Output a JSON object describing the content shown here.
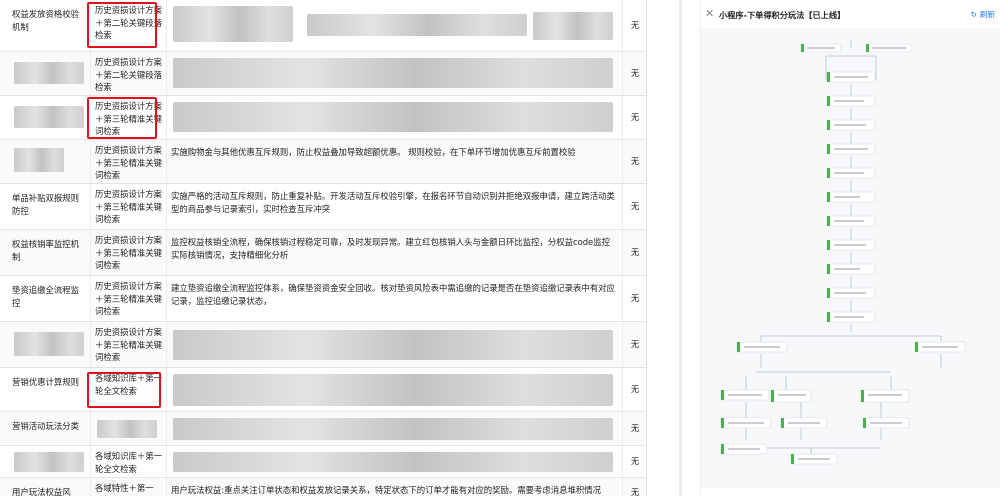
{
  "table": {
    "rows": [
      {
        "name": "权益发放资格校验机制",
        "method": "历史资损设计方案＋第二轮关键段落检索",
        "desc": "",
        "result": "无",
        "highlight": true
      },
      {
        "name": "",
        "method": "历史资损设计方案＋第二轮关键段落检索",
        "desc": "",
        "result": "无",
        "highlight": false
      },
      {
        "name": "",
        "method": "历史资损设计方案＋第三轮精准关键词检索",
        "desc": "",
        "result": "无",
        "highlight": true
      },
      {
        "name": "",
        "method": "历史资损设计方案＋第三轮精准关键词检索",
        "desc": "实施购物金与其他优惠互斥规则，防止权益叠加导致超额优惠。                              规则校验，在下单环节增加优惠互斥前置校验",
        "result": "无",
        "highlight": false
      },
      {
        "name": "单品补贴双报规则防控",
        "method": "历史资损设计方案＋第三轮精准关键词检索",
        "desc": "实施严格的活动互斥规则，防止重复补贴。开发活动互斥校验引擎，在报名环节自动识别并拒绝双报申请，建立跨活动类型的商品参与记录索引，实时检查互斥冲突",
        "result": "无",
        "highlight": false
      },
      {
        "name": "权益核销率监控机制",
        "method": "历史资损设计方案＋第三轮精准关键词检索",
        "desc": "监控权益核销全流程，确保核销过程稳定可靠，及时发现异常。建立红包核销人头与金额日环比监控，分权益code监控实际核销情况，支持精细化分析",
        "result": "无",
        "highlight": false
      },
      {
        "name": "垫资追缴全流程监控",
        "method": "历史资损设计方案＋第三轮精准关键词检索",
        "desc": "建立垫资追缴全流程监控体系，确保垫资资金安全回收。核对垫资风险表中需追缴的记录是否在垫资追缴记录表中有对应记录，监控追缴记录状态，",
        "result": "无",
        "highlight": false
      },
      {
        "name": "",
        "method": "历史资损设计方案＋第三轮精准关键词检索",
        "desc": "",
        "result": "无",
        "highlight": false
      },
      {
        "name": "营销优惠计算规则",
        "method": "各域知识库＋第一轮全文检索",
        "desc": "",
        "result": "无",
        "highlight": true
      },
      {
        "name": "营销活动玩法分类",
        "method": "",
        "desc": "",
        "result": "无",
        "highlight": false
      },
      {
        "name": "",
        "method": "各域知识库＋第一轮全文检索",
        "desc": "",
        "result": "无",
        "highlight": false
      },
      {
        "name": "用户玩法权益风",
        "method": "各域特性＋第一",
        "desc": "用户玩法权益:重点关注订单状态和权益发放记录关系，特定状态下的订单才能有对应的奖励。需要考虑消息堆积情况",
        "result": "无",
        "highlight": false
      }
    ]
  },
  "panel": {
    "title": "小程序-下单得积分玩法【已上线】",
    "refresh_label": "刷新",
    "close_icon": "close-icon",
    "refresh_icon": "refresh-icon",
    "accent": "#1677ff",
    "node_color": "#4caf50"
  }
}
